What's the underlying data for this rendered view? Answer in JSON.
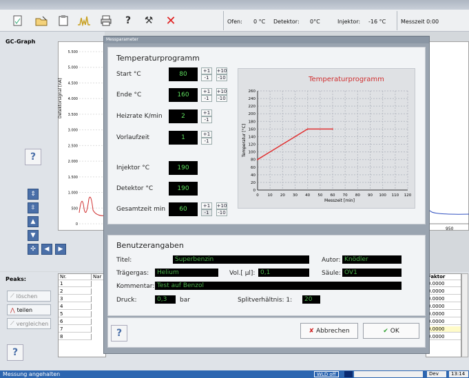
{
  "toolbar": {
    "status": {
      "oven_label": "Ofen:",
      "oven_value": "0 °C",
      "detector_label": "Detektor:",
      "detector_value": "0°C",
      "injector_label": "Injektor:",
      "injector_value": "-16 °C",
      "time_label": "Messzeit 0:00"
    },
    "icons": [
      "new-document-icon",
      "open-folder-icon",
      "clipboard-icon",
      "chromatogram-icon",
      "print-icon",
      "help-icon",
      "tools-icon",
      "close-icon"
    ]
  },
  "left": {
    "title": "GC-Graph",
    "y_axis_label": "Detektorsignal [nA]",
    "y_ticks": [
      "5.500",
      "5.000",
      "4.500",
      "4.000",
      "3.500",
      "3.000",
      "2.500",
      "2.000",
      "1.500",
      "1.000",
      "500",
      "0"
    ]
  },
  "right": {
    "x_tick": "950"
  },
  "dialog": {
    "window_title": "Messparameter",
    "temp_section": {
      "heading": "Temperaturprogramm",
      "start_label": "Start °C",
      "start_value": "80",
      "end_label": "Ende °C",
      "end_value": "160",
      "rate_label": "Heizrate K/min",
      "rate_value": "2",
      "pre_label": "Vorlaufzeit",
      "pre_value": "1",
      "injector_label": "Injektor °C",
      "injector_value": "190",
      "detector_label": "Detektor °C",
      "detector_value": "190",
      "total_label": "Gesamtzeit min",
      "total_value": "60",
      "steps": {
        "plus1": "+1",
        "minus1": "-1",
        "plus10": "+10",
        "minus10": "-10"
      }
    },
    "user_section": {
      "heading": "Benutzerangaben",
      "title_label": "Titel:",
      "title_value": "Superbenzin",
      "author_label": "Autor:",
      "author_value": "Knödler",
      "carrier_label": "Trägergas:",
      "carrier_value": "Helium",
      "vol_label": "Vol.[ µl]:",
      "vol_value": "0,1",
      "column_label": "Säule:",
      "column_value": "OV1",
      "comment_label": "Kommentar:",
      "comment_value": "Test auf Benzol",
      "pressure_label": "Druck:",
      "pressure_value": "0,3",
      "pressure_unit": "bar",
      "split_label": "Splitverhältnis:  1:",
      "split_value": "20"
    },
    "cancel_label": "Abbrechen",
    "ok_label": "OK"
  },
  "chart_data": {
    "type": "line",
    "title": "Temperaturprogramm",
    "xlabel": "Messzeit  [min]",
    "ylabel": "Temperatur [°C]",
    "xlim": [
      0,
      120
    ],
    "ylim": [
      0,
      260
    ],
    "x_ticks": [
      0,
      10,
      20,
      30,
      40,
      50,
      60,
      70,
      80,
      90,
      100,
      110,
      120
    ],
    "y_ticks": [
      0,
      20,
      40,
      60,
      80,
      100,
      120,
      140,
      160,
      180,
      200,
      220,
      240,
      260
    ],
    "grid": true,
    "series": [
      {
        "x": [
          0,
          40,
          60
        ],
        "y": [
          80,
          160,
          160
        ],
        "color": "#e03030"
      }
    ]
  },
  "bottom": {
    "peaks_label": "Peaks:",
    "delete_label": "löschen",
    "split_label": "teilen",
    "compare_label": "vergleichen",
    "col_nr": "Nr.",
    "col_name": "Nar",
    "rows": [
      "1",
      "2",
      "3",
      "4",
      "5",
      "6",
      "7",
      "8"
    ],
    "factor_header": "Faktor",
    "factors": [
      "0.0000",
      "0.0000",
      "0.0000",
      "0.0000",
      "0.0000",
      "0.0000",
      "0.0000",
      "0.0000"
    ]
  },
  "statusbar": {
    "message": "Messung angehalten",
    "wld": "WLD off",
    "dev": "Dev",
    "clock": "13:14"
  },
  "colors": {
    "accent": "#2d66b0",
    "led_green": "#5fe05f",
    "plot_red": "#e03030"
  }
}
